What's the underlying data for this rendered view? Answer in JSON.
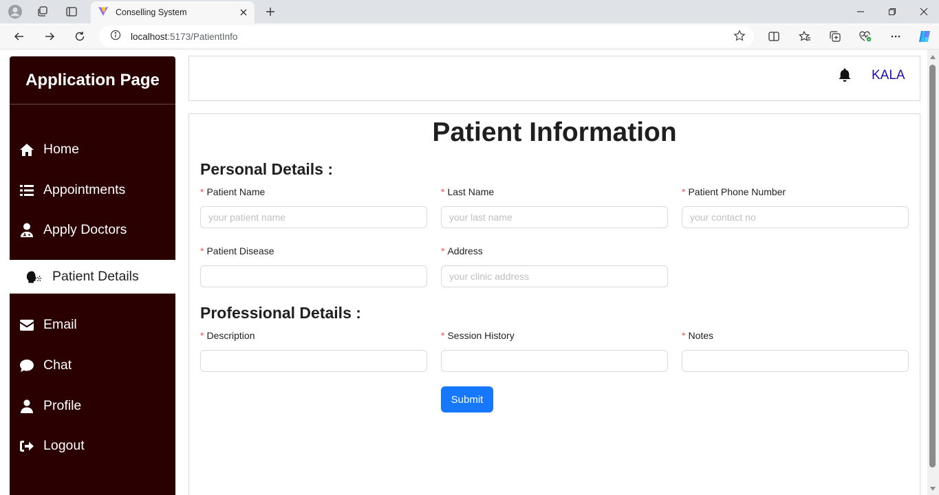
{
  "browser": {
    "tab_title": "Conselling System",
    "url_host": "localhost",
    "url_path": ":5173/PatientInfo"
  },
  "sidebar": {
    "brand": "Application Page",
    "items": [
      {
        "label": "Home",
        "icon": "home-icon"
      },
      {
        "label": "Appointments",
        "icon": "list-icon"
      },
      {
        "label": "Apply Doctors",
        "icon": "user-doctor-icon"
      },
      {
        "label": "Patient Details",
        "icon": "head-side-cough-icon",
        "active": true
      },
      {
        "label": "Email",
        "icon": "envelope-icon"
      },
      {
        "label": "Chat",
        "icon": "comment-icon"
      },
      {
        "label": "Profile",
        "icon": "user-icon"
      },
      {
        "label": "Logout",
        "icon": "logout-icon"
      }
    ]
  },
  "header": {
    "user_name": "KALA"
  },
  "form": {
    "title": "Patient Information",
    "personal_heading": "Personal Details :",
    "professional_heading": "Professional Details :",
    "fields": {
      "patient_name": {
        "label": "Patient Name",
        "placeholder": "your patient name",
        "value": ""
      },
      "last_name": {
        "label": "Last Name",
        "placeholder": "your last name",
        "value": ""
      },
      "phone": {
        "label": "Patient Phone Number",
        "placeholder": "your contact no",
        "value": ""
      },
      "disease": {
        "label": "Patient Disease",
        "placeholder": "",
        "value": ""
      },
      "address": {
        "label": "Address",
        "placeholder": "your clinic address",
        "value": ""
      },
      "description": {
        "label": "Description",
        "placeholder": "",
        "value": ""
      },
      "session_history": {
        "label": "Session History",
        "placeholder": "",
        "value": ""
      },
      "notes": {
        "label": "Notes",
        "placeholder": "",
        "value": ""
      }
    },
    "required_mark": "*",
    "submit_label": "Submit"
  },
  "colors": {
    "sidebar_bg": "#2b0000",
    "accent": "#1677ff",
    "user_link": "#1a0dab",
    "required": "#ff4d4f"
  }
}
